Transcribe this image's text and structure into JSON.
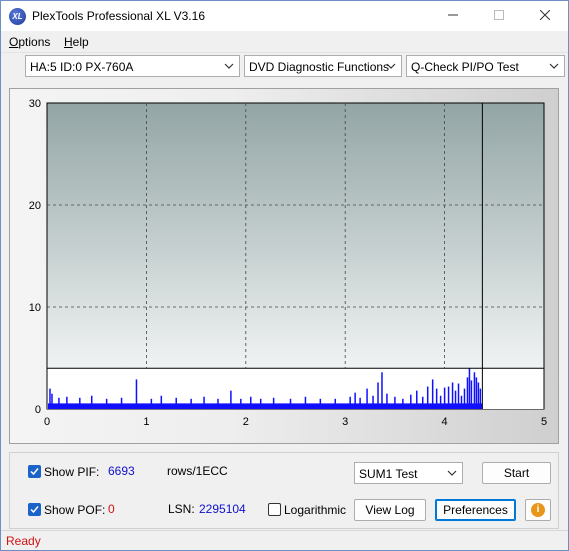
{
  "window": {
    "title": "PlexTools Professional XL V3.16",
    "icon_text": "XL",
    "controls": [
      "minimize-icon",
      "maximize-icon",
      "close-icon"
    ]
  },
  "menu": {
    "items": [
      {
        "label": "Options",
        "underline": "O"
      },
      {
        "label": "Help",
        "underline": "H"
      }
    ]
  },
  "toolbar": {
    "drive": "HA:5 ID:0  PX-760A",
    "function": "DVD Diagnostic Functions",
    "test": "Q-Check PI/PO Test"
  },
  "chart_data": {
    "type": "bar",
    "xlim": [
      0,
      5
    ],
    "ylim": [
      0,
      30
    ],
    "x_ticks": [
      "0",
      "1",
      "2",
      "3",
      "4",
      "5"
    ],
    "y_ticks": [
      "0",
      "10",
      "20",
      "30"
    ],
    "grid": true,
    "grid_style": "dashed",
    "threshold_line": 4,
    "end_marker_x": 4.38,
    "series": [
      {
        "color": "#1010ff",
        "baseline": 0.55,
        "spikes": [
          {
            "x": 0.03,
            "y": 2.0
          },
          {
            "x": 0.05,
            "y": 1.5
          },
          {
            "x": 0.12,
            "y": 1.1
          },
          {
            "x": 0.2,
            "y": 1.2
          },
          {
            "x": 0.33,
            "y": 1.1
          },
          {
            "x": 0.45,
            "y": 1.3
          },
          {
            "x": 0.6,
            "y": 1.0
          },
          {
            "x": 0.75,
            "y": 1.1
          },
          {
            "x": 0.9,
            "y": 2.9
          },
          {
            "x": 1.05,
            "y": 1.0
          },
          {
            "x": 1.15,
            "y": 1.3
          },
          {
            "x": 1.3,
            "y": 1.1
          },
          {
            "x": 1.45,
            "y": 1.0
          },
          {
            "x": 1.58,
            "y": 1.2
          },
          {
            "x": 1.72,
            "y": 1.0
          },
          {
            "x": 1.85,
            "y": 1.8
          },
          {
            "x": 1.95,
            "y": 1.0
          },
          {
            "x": 2.05,
            "y": 1.2
          },
          {
            "x": 2.15,
            "y": 1.0
          },
          {
            "x": 2.28,
            "y": 1.1
          },
          {
            "x": 2.45,
            "y": 1.0
          },
          {
            "x": 2.6,
            "y": 1.2
          },
          {
            "x": 2.75,
            "y": 1.0
          },
          {
            "x": 2.9,
            "y": 1.0
          },
          {
            "x": 3.05,
            "y": 1.2
          },
          {
            "x": 3.1,
            "y": 1.6
          },
          {
            "x": 3.15,
            "y": 1.1
          },
          {
            "x": 3.22,
            "y": 2.0
          },
          {
            "x": 3.28,
            "y": 1.3
          },
          {
            "x": 3.33,
            "y": 2.6
          },
          {
            "x": 3.37,
            "y": 3.6
          },
          {
            "x": 3.42,
            "y": 1.5
          },
          {
            "x": 3.5,
            "y": 1.2
          },
          {
            "x": 3.58,
            "y": 1.0
          },
          {
            "x": 3.66,
            "y": 1.4
          },
          {
            "x": 3.72,
            "y": 1.8
          },
          {
            "x": 3.78,
            "y": 1.2
          },
          {
            "x": 3.83,
            "y": 2.2
          },
          {
            "x": 3.88,
            "y": 2.9
          },
          {
            "x": 3.92,
            "y": 2.0
          },
          {
            "x": 3.96,
            "y": 1.3
          },
          {
            "x": 4.0,
            "y": 2.1
          },
          {
            "x": 4.04,
            "y": 2.2
          },
          {
            "x": 4.08,
            "y": 2.6
          },
          {
            "x": 4.11,
            "y": 1.8
          },
          {
            "x": 4.14,
            "y": 2.5
          },
          {
            "x": 4.17,
            "y": 1.3
          },
          {
            "x": 4.2,
            "y": 2.0
          },
          {
            "x": 4.23,
            "y": 3.1
          },
          {
            "x": 4.25,
            "y": 4.0
          },
          {
            "x": 4.27,
            "y": 2.8
          },
          {
            "x": 4.3,
            "y": 3.6
          },
          {
            "x": 4.32,
            "y": 3.1
          },
          {
            "x": 4.34,
            "y": 2.6
          },
          {
            "x": 4.36,
            "y": 2.0
          }
        ]
      }
    ]
  },
  "stats": {
    "show_pif_label": "Show PIF:",
    "pif_value": "6693",
    "pif_unit": "rows/1ECC",
    "show_pof_label": "Show POF:",
    "pof_value": "0",
    "lsn_label": "LSN:",
    "lsn_value": "2295104",
    "logarithmic_label": "Logarithmic",
    "show_pif_checked": true,
    "show_pof_checked": true,
    "logarithmic_checked": false
  },
  "controls": {
    "sum_select": "SUM1 Test",
    "start": "Start",
    "view_log": "View Log",
    "preferences": "Preferences",
    "info_icon": "i"
  },
  "status": {
    "text": "Ready",
    "color": "#d11212"
  },
  "colors": {
    "pif_value": "#1010cc",
    "pof_value": "#d11212",
    "bars": "#1010ff",
    "plot_bg_top": "#93a5a5",
    "plot_bg_bottom": "#ffffff"
  }
}
